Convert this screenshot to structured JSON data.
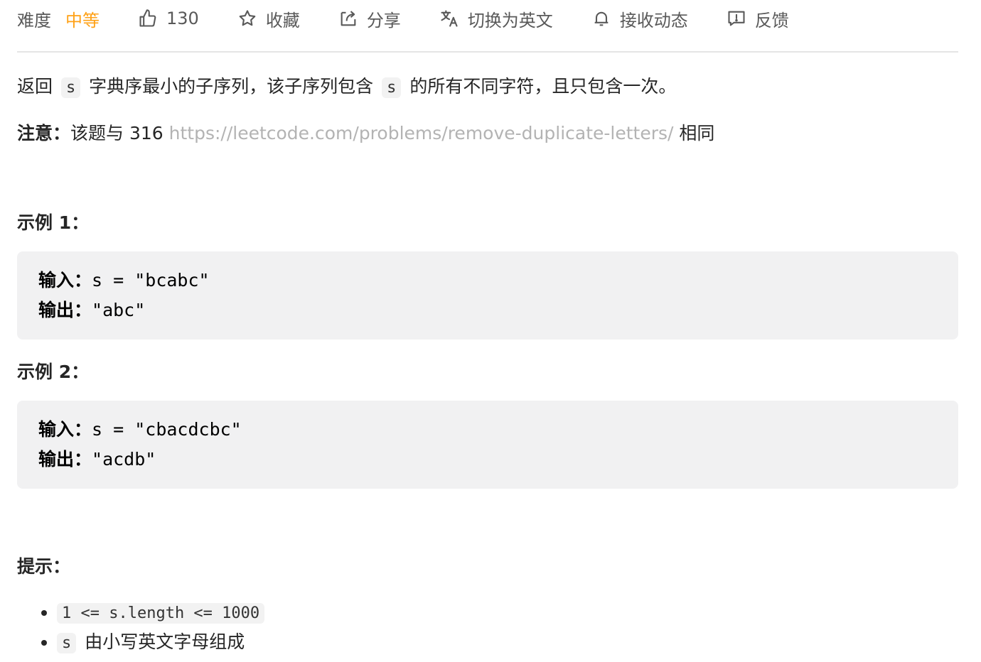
{
  "toolbar": {
    "difficulty_label": "难度",
    "difficulty_value": "中等",
    "likes": "130",
    "favorite": "收藏",
    "share": "分享",
    "switch_lang": "切换为英文",
    "subscribe": "接收动态",
    "feedback": "反馈",
    "difficulty_color": "#ffa116"
  },
  "description": {
    "part1": "返回",
    "code1": "s",
    "part2": "字典序最小的子序列，该子序列包含",
    "code2": "s",
    "part3": "的所有不同字符，且只包含一次。"
  },
  "note": {
    "label": "注意：",
    "text1": "该题与 316 ",
    "link": "https://leetcode.com/problems/remove-duplicate-letters/",
    "text2": " 相同"
  },
  "examples": [
    {
      "title": "示例 1：",
      "input_label": "输入：",
      "input_value": "s = \"bcabc\"",
      "output_label": "输出：",
      "output_value": "\"abc\""
    },
    {
      "title": "示例 2：",
      "input_label": "输入：",
      "input_value": "s = \"cbacdcbc\"",
      "output_label": "输出：",
      "output_value": "\"acdb\""
    }
  ],
  "hints": {
    "title": "提示：",
    "items": [
      {
        "code": "1 <= s.length <= 1000",
        "text": ""
      },
      {
        "code": "s",
        "text": "由小写英文字母组成"
      }
    ]
  }
}
